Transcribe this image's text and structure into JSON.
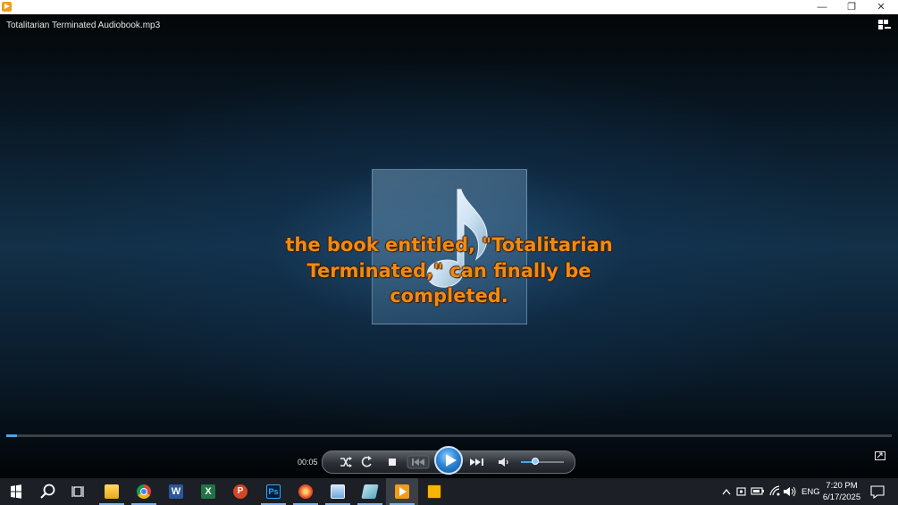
{
  "window": {
    "title": "",
    "controls": {
      "minimize": "—",
      "maximize": "❐",
      "close": "✕"
    }
  },
  "player": {
    "file_title": "Totalitarian Terminated Audiobook.mp3",
    "lyrics": [
      "the book entitled, \"Totalitarian",
      "Terminated,\" can finally be",
      "completed."
    ],
    "elapsed": "00:05",
    "progress_fraction": 0.012,
    "volume_fraction": 0.33,
    "buttons": {
      "shuffle": "shuffle-icon",
      "repeat": "repeat-icon",
      "stop": "stop-icon",
      "previous": "previous-icon",
      "play": "play-icon",
      "next": "next-icon",
      "mute": "speaker-icon"
    },
    "accent_color": "#f08a14"
  },
  "taskbar": {
    "apps": [
      "start",
      "search",
      "task-view",
      "file-explorer",
      "chrome",
      "word",
      "excel",
      "powerpoint",
      "photoshop",
      "app-red",
      "photos",
      "notepad",
      "media-player",
      "audio-app"
    ],
    "language": "ENG",
    "time": "7:20 PM",
    "date": "6/17/2025"
  }
}
